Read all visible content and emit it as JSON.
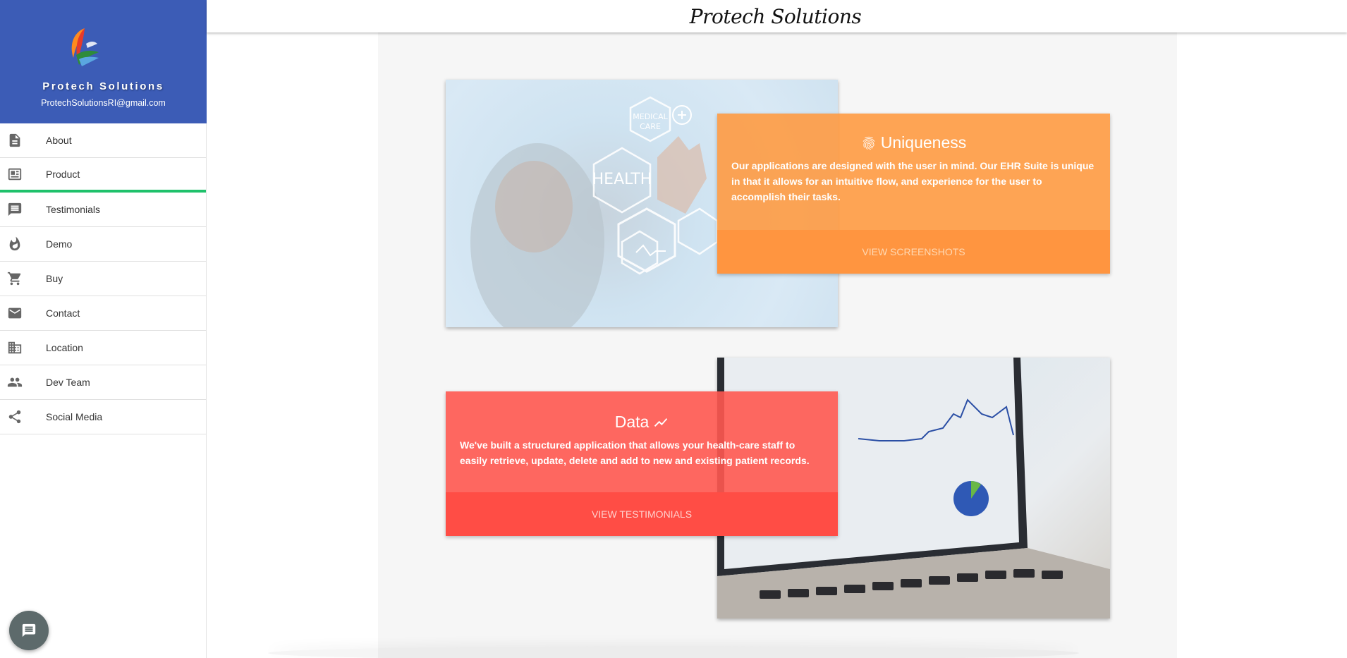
{
  "header": {
    "title": "Protech Solutions"
  },
  "sidebar": {
    "brand_name": "Protech Solutions",
    "email": "ProtechSolutionsRI@gmail.com",
    "items": [
      {
        "label": "About",
        "icon": "document-icon"
      },
      {
        "label": "Product",
        "icon": "newspaper-icon",
        "active": true
      },
      {
        "label": "Testimonials",
        "icon": "comment-icon"
      },
      {
        "label": "Demo",
        "icon": "fire-icon"
      },
      {
        "label": "Buy",
        "icon": "cart-icon"
      },
      {
        "label": "Contact",
        "icon": "mail-icon"
      },
      {
        "label": "Location",
        "icon": "building-icon"
      },
      {
        "label": "Dev Team",
        "icon": "people-icon"
      },
      {
        "label": "Social Media",
        "icon": "share-icon"
      }
    ]
  },
  "cards": {
    "uniqueness": {
      "title": "Uniqueness",
      "icon": "fingerprint-icon",
      "body": "Our applications are designed with the user in mind. Our EHR Suite is unique in that it allows for an intuitive flow, and experience for the user to accomplish their tasks.",
      "action": "VIEW SCREENSHOTS"
    },
    "data": {
      "title": "Data",
      "icon": "trending-up-icon",
      "body": "We've built a structured application that allows your health-care staff to easily retrieve, update, delete and add to new and existing patient records.",
      "action": "VIEW TESTIMONIALS"
    }
  },
  "colors": {
    "sidebar_header": "#3c5cb6",
    "active_indicator": "#1fc16b",
    "uniqueness_card": "#ff9a45",
    "data_card": "#ff5a52",
    "chat_button": "#5d6a6b"
  }
}
